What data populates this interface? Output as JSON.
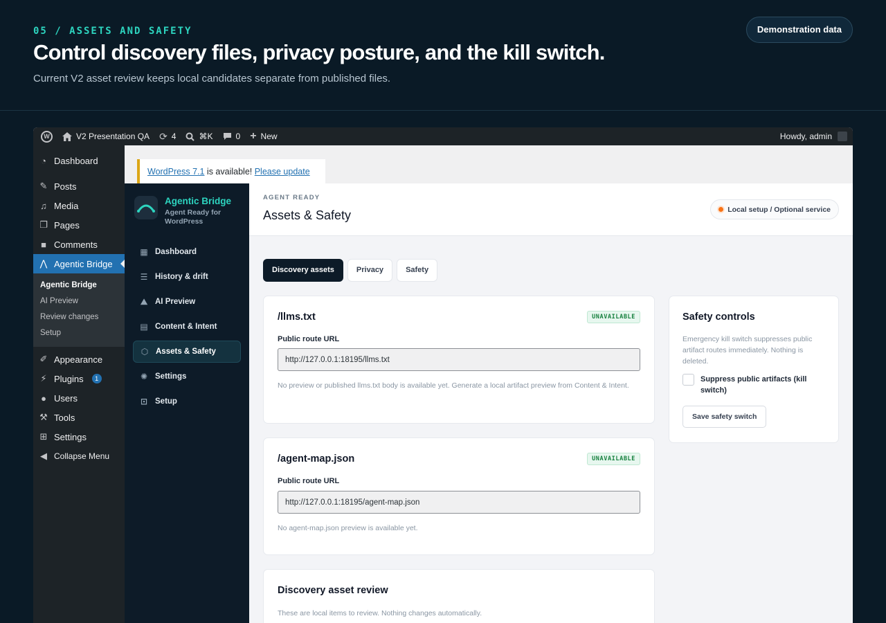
{
  "presentation": {
    "eyebrow": "05 / ASSETS AND SAFETY",
    "title": "Control discovery files, privacy posture, and the kill switch.",
    "subtitle": "Current V2 asset review keeps local candidates separate from published files.",
    "badge": "Demonstration data"
  },
  "adminbar": {
    "site_name": "V2 Presentation QA",
    "updates_count": "4",
    "search_shortcut": "⌘K",
    "comments_count": "0",
    "new_label": "New",
    "howdy": "Howdy, admin"
  },
  "adminmenu": {
    "items": [
      {
        "label": "Dashboard",
        "icon": "dashboard-icon"
      },
      {
        "label": "Posts",
        "icon": "pin-icon"
      },
      {
        "label": "Media",
        "icon": "media-icon"
      },
      {
        "label": "Pages",
        "icon": "pages-icon"
      },
      {
        "label": "Comments",
        "icon": "comment-icon"
      },
      {
        "label": "Agentic Bridge",
        "icon": "bridge-icon"
      },
      {
        "label": "Appearance",
        "icon": "brush-icon"
      },
      {
        "label": "Plugins",
        "icon": "plug-icon",
        "badge": "1"
      },
      {
        "label": "Users",
        "icon": "user-icon"
      },
      {
        "label": "Tools",
        "icon": "wrench-icon"
      },
      {
        "label": "Settings",
        "icon": "settings-icon"
      },
      {
        "label": "Collapse Menu",
        "icon": "collapse-icon"
      }
    ],
    "submenu": [
      "Agentic Bridge",
      "AI Preview",
      "Review changes",
      "Setup"
    ]
  },
  "notice": {
    "version_link": "WordPress 7.1",
    "text": " is available! ",
    "update_link": "Please update now",
    "period": "."
  },
  "plugin": {
    "brand_name": "Agentic Bridge",
    "brand_tagline": "Agent Ready for WordPress",
    "nav": [
      {
        "label": "Dashboard",
        "icon": "grid-icon"
      },
      {
        "label": "History & drift",
        "icon": "sliders-icon"
      },
      {
        "label": "AI Preview",
        "icon": "preview-icon"
      },
      {
        "label": "Content & Intent",
        "icon": "document-icon"
      },
      {
        "label": "Assets & Safety",
        "icon": "shield-icon"
      },
      {
        "label": "Settings",
        "icon": "gear-icon"
      },
      {
        "label": "Setup",
        "icon": "setup-icon"
      }
    ],
    "active_nav": "Assets & Safety"
  },
  "page": {
    "eyebrow": "AGENT READY",
    "title": "Assets & Safety",
    "status": "Local setup / Optional service",
    "status_color": "#f97316",
    "tabs": [
      "Discovery assets",
      "Privacy",
      "Safety"
    ],
    "active_tab": "Discovery assets"
  },
  "assets": {
    "llms": {
      "title": "/llms.txt",
      "badge": "UNAVAILABLE",
      "field_label": "Public route URL",
      "url": "http://127.0.0.1:18195/llms.txt",
      "note": "No preview or published llms.txt body is available yet. Generate a local artifact preview from Content & Intent."
    },
    "agent_map": {
      "title": "/agent-map.json",
      "badge": "UNAVAILABLE",
      "field_label": "Public route URL",
      "url": "http://127.0.0.1:18195/agent-map.json",
      "note": "No agent-map.json preview is available yet."
    },
    "review": {
      "title": "Discovery asset review",
      "note": "These are local items to review. Nothing changes automatically."
    }
  },
  "safety": {
    "title": "Safety controls",
    "description": "Emergency kill switch suppresses public artifact routes immediately. Nothing is deleted.",
    "checkbox_label": "Suppress public artifacts (kill switch)",
    "checkbox_checked": false,
    "button": "Save safety switch"
  },
  "colors": {
    "accent": "#2dd4bf",
    "wp_blue": "#2271b1",
    "badge_green": "#15803d"
  }
}
